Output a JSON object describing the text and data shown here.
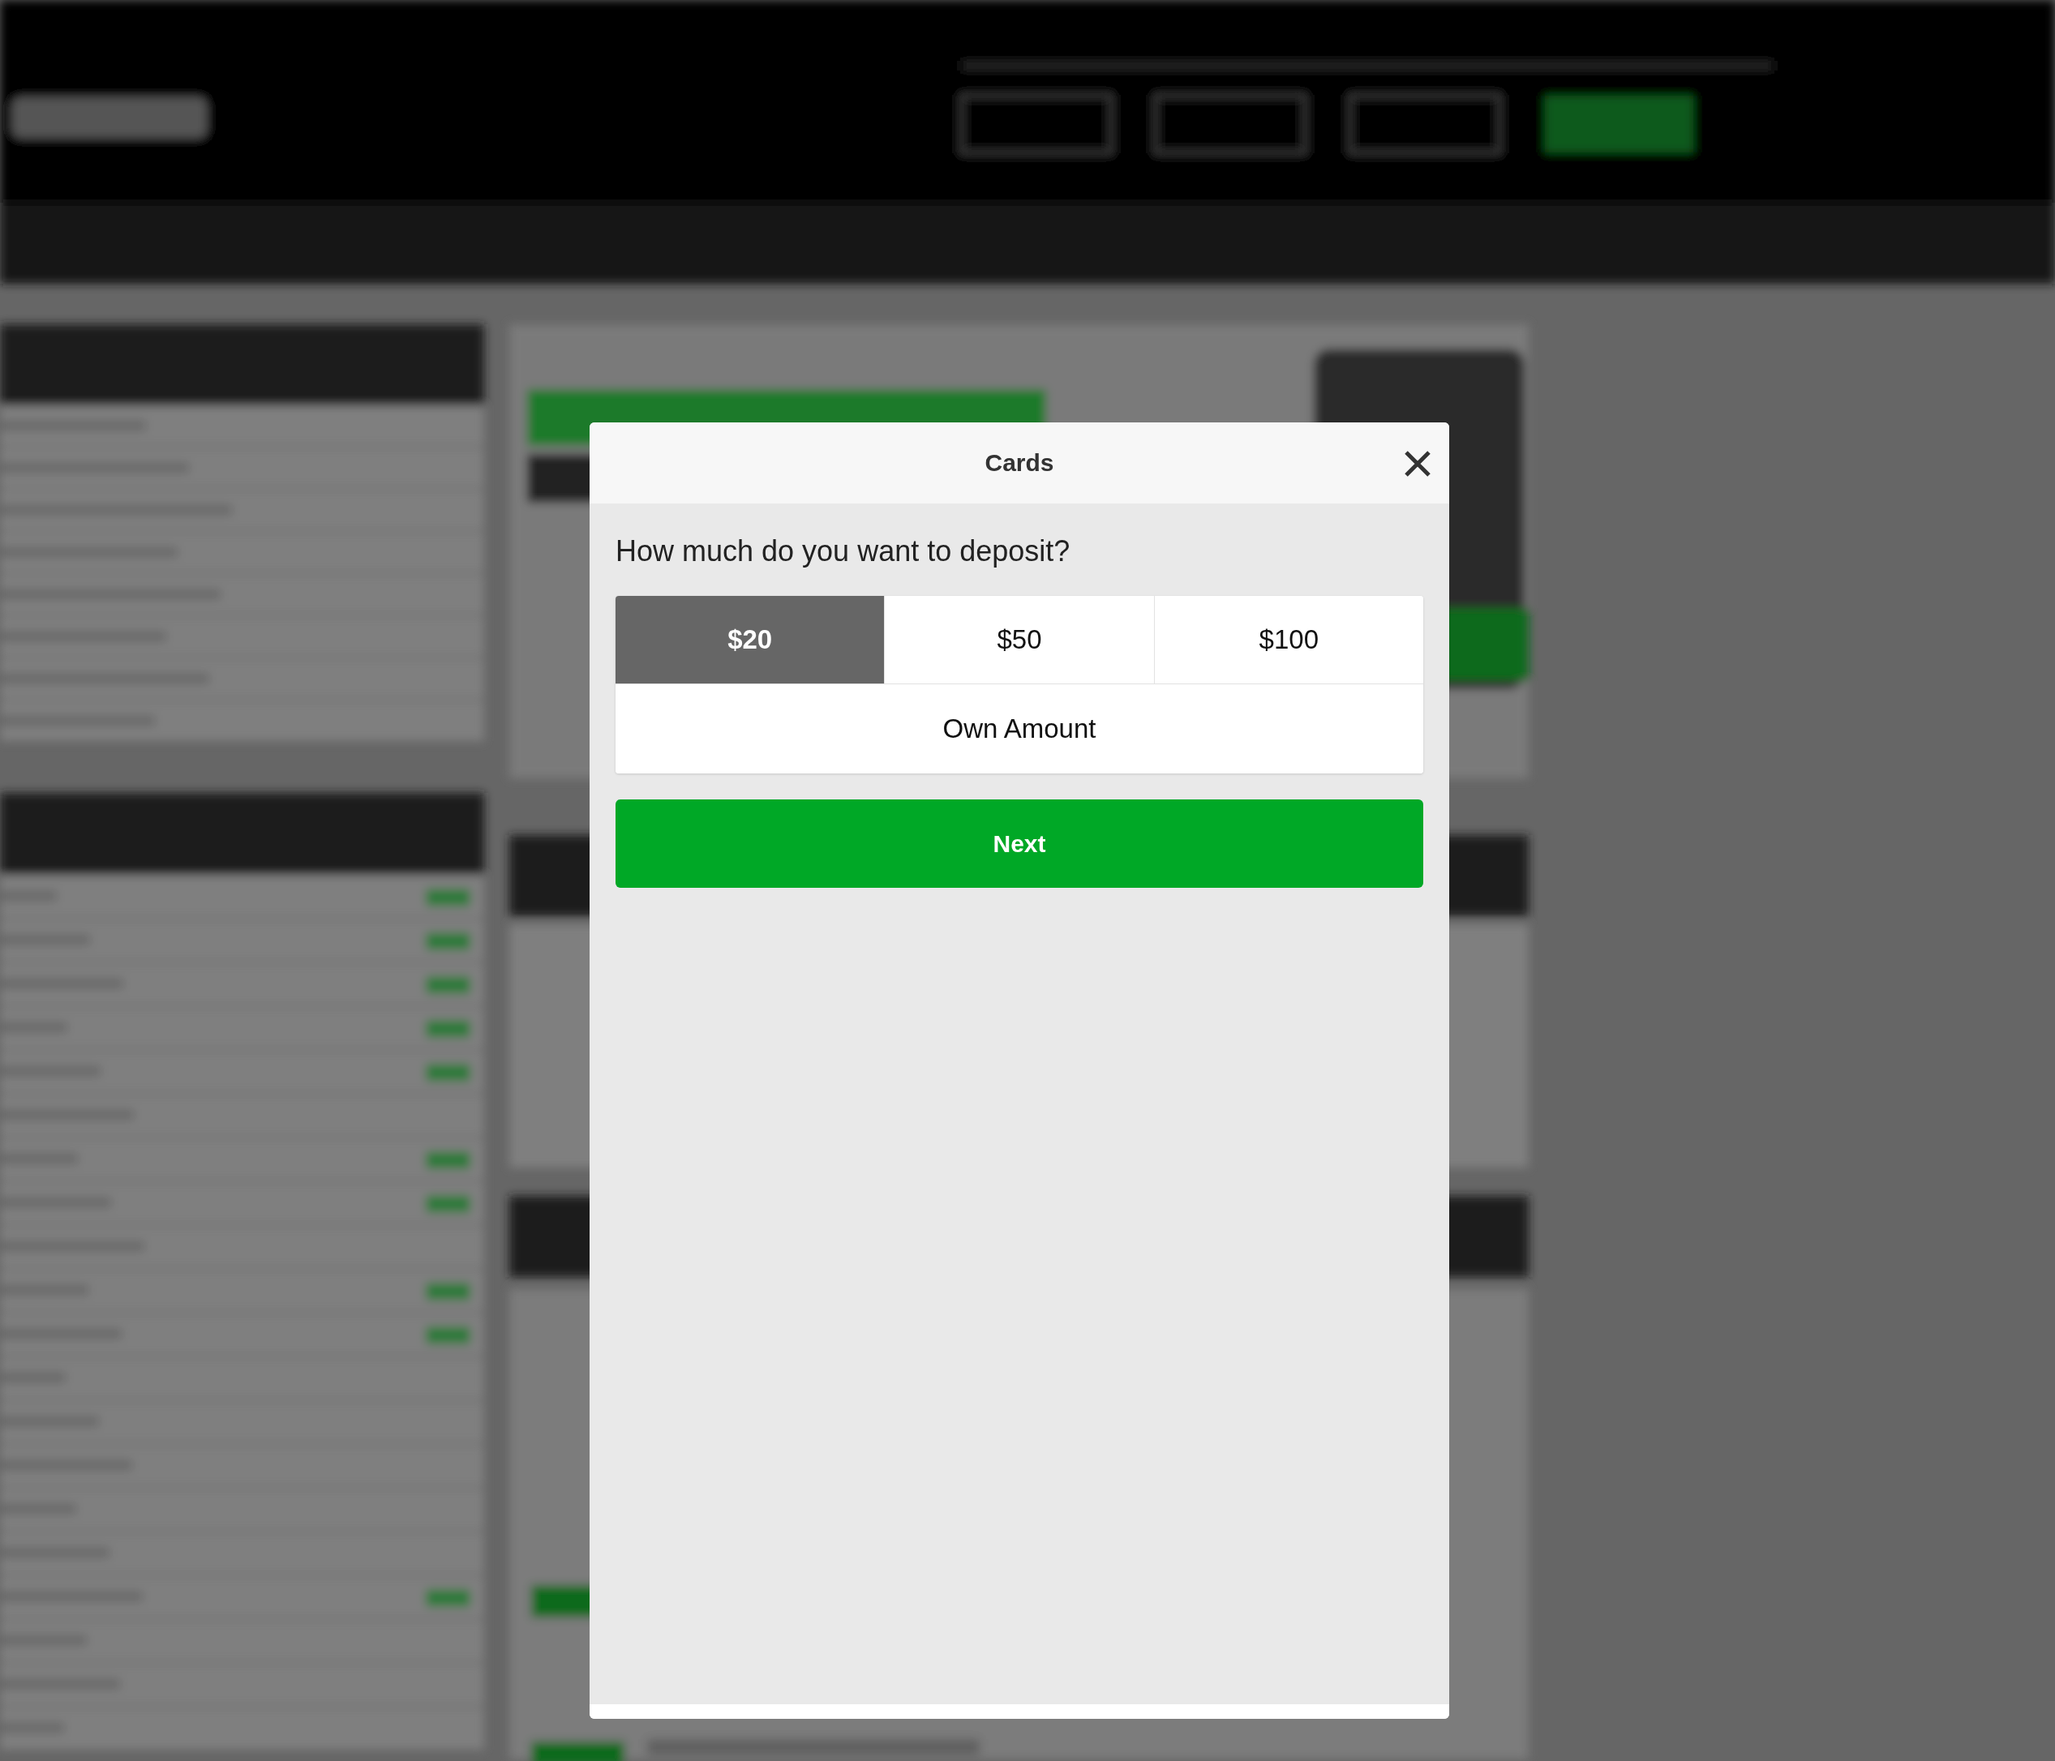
{
  "dialog": {
    "title": "Cards",
    "question": "How much do you want to deposit?",
    "amounts": [
      {
        "label": "$20",
        "selected": true
      },
      {
        "label": "$50",
        "selected": false
      },
      {
        "label": "$100",
        "selected": false
      }
    ],
    "own_amount": {
      "label": "Own Amount",
      "selected": false
    },
    "next_button": "Next"
  }
}
